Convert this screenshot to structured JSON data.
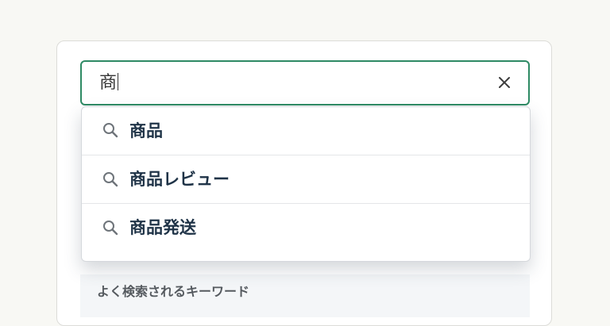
{
  "search": {
    "value": "商",
    "clear_icon": "close-icon"
  },
  "suggestions": [
    {
      "label": "商品",
      "icon": "search-icon"
    },
    {
      "label": "商品レビュー",
      "icon": "search-icon"
    },
    {
      "label": "商品発送",
      "icon": "search-icon"
    }
  ],
  "popular": {
    "heading": "よく検索されるキーワード"
  },
  "colors": {
    "focus_border": "#2e8a64",
    "suggestion_text": "#1f3347",
    "page_background": "#f8f8f4"
  }
}
